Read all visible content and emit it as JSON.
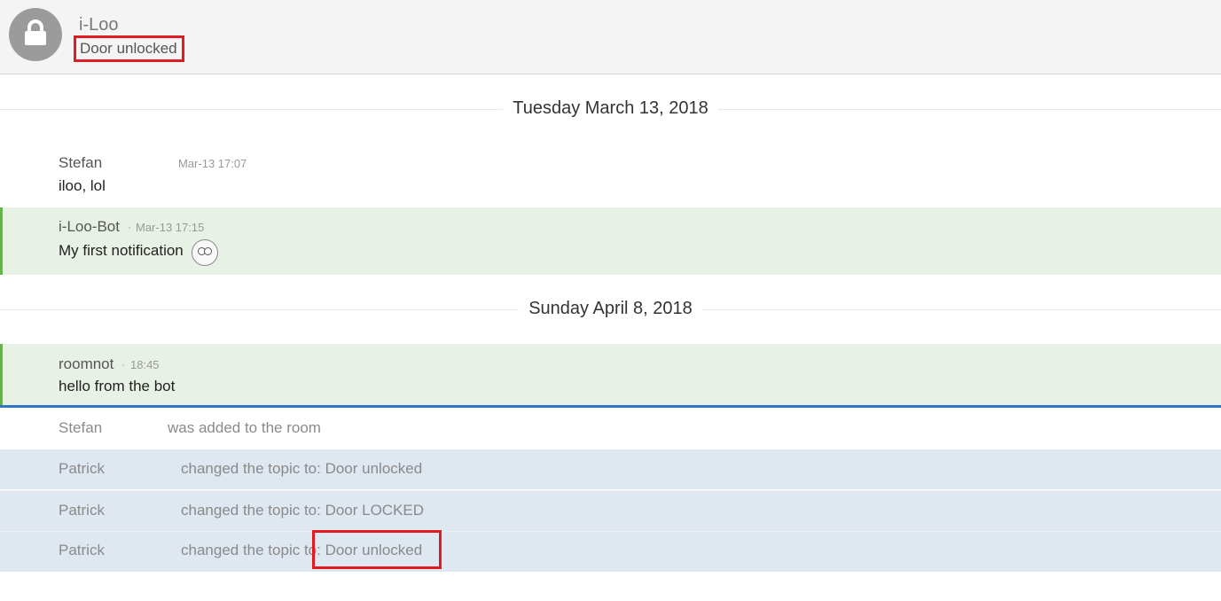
{
  "room": {
    "name": "i-Loo",
    "topic": "Door unlocked",
    "avatar_icon": "lock-icon"
  },
  "date_separators": [
    "Tuesday March 13, 2018",
    "Sunday April 8, 2018"
  ],
  "messages": [
    {
      "sender": "Stefan",
      "timestamp": "Mar-13 17:07",
      "body": "iloo, lol"
    },
    {
      "sender": "i-Loo-Bot",
      "separator": "·",
      "timestamp": "Mar-13 17:15",
      "body": "My first notification",
      "emoji": "emoji-face-icon"
    },
    {
      "sender": "roomnot",
      "separator": "·",
      "timestamp": "18:45",
      "body": "hello from the bot"
    }
  ],
  "events": [
    {
      "who": "Stefan",
      "what": "was added to the room"
    },
    {
      "who": "Patrick",
      "what": "changed the topic to: Door unlocked"
    },
    {
      "who": "Patrick",
      "what": "changed the topic to: Door LOCKED"
    },
    {
      "who": "Patrick",
      "what": "changed the topic to: Door unlocked"
    }
  ],
  "colors": {
    "highlight_box": "#e21b23",
    "notification_bg": "#e8f1e5",
    "notification_border": "#6ab04c",
    "read_marker": "#2f77c1",
    "topic_event_bg": "#dfe7f0"
  }
}
